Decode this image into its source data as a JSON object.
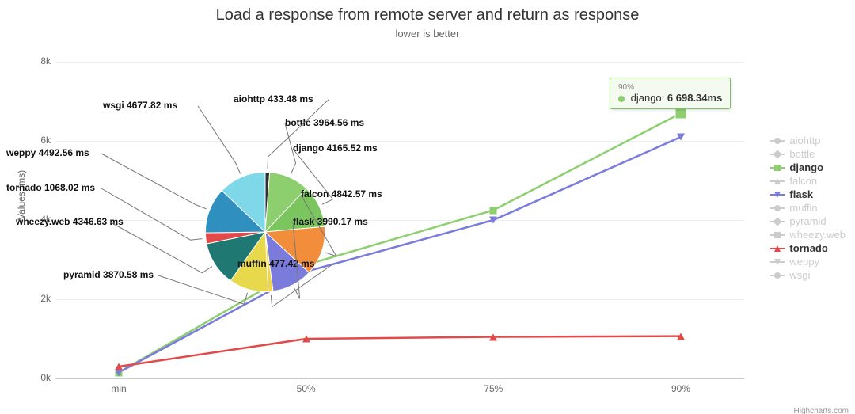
{
  "title": "Load a response from remote server and return as response",
  "subtitle": "lower is better",
  "y_axis_title": "Values (ms)",
  "credits": "Highcharts.com",
  "y_ticks": [
    "0k",
    "2k",
    "4k",
    "6k",
    "8k"
  ],
  "x_ticks": [
    "min",
    "50%",
    "75%",
    "90%"
  ],
  "tooltip": {
    "category": "90%",
    "series": "django",
    "value": "6 698.34ms",
    "color": "#8dce6f"
  },
  "legend": [
    {
      "name": "aiohttp",
      "active": false,
      "color": "#cccccc",
      "marker": "circle"
    },
    {
      "name": "bottle",
      "active": false,
      "color": "#cccccc",
      "marker": "diamond"
    },
    {
      "name": "django",
      "active": true,
      "color": "#8dce6f",
      "marker": "square",
      "bold": true
    },
    {
      "name": "falcon",
      "active": false,
      "color": "#cccccc",
      "marker": "tri-up"
    },
    {
      "name": "flask",
      "active": true,
      "color": "#7b7bdc",
      "marker": "tri-down",
      "bold": true
    },
    {
      "name": "muffin",
      "active": false,
      "color": "#cccccc",
      "marker": "circle"
    },
    {
      "name": "pyramid",
      "active": false,
      "color": "#cccccc",
      "marker": "diamond"
    },
    {
      "name": "wheezy.web",
      "active": false,
      "color": "#cccccc",
      "marker": "square"
    },
    {
      "name": "tornado",
      "active": true,
      "color": "#e24a4a",
      "marker": "tri-up",
      "bold": true
    },
    {
      "name": "weppy",
      "active": false,
      "color": "#cccccc",
      "marker": "tri-down"
    },
    {
      "name": "wsgi",
      "active": false,
      "color": "#cccccc",
      "marker": "circle"
    }
  ],
  "pie": [
    {
      "name": "aiohttp",
      "value": 433.48,
      "color": "#2f2f2f"
    },
    {
      "name": "bottle",
      "value": 3964.56,
      "color": "#8dce6f"
    },
    {
      "name": "django",
      "value": 4165.52,
      "color": "#7bc55e"
    },
    {
      "name": "falcon",
      "value": 4842.57,
      "color": "#f28d3c"
    },
    {
      "name": "flask",
      "value": 3990.17,
      "color": "#7b7bdc"
    },
    {
      "name": "muffin",
      "value": 477.42,
      "color": "#f2d44c"
    },
    {
      "name": "pyramid",
      "value": 3870.58,
      "color": "#e8d84c"
    },
    {
      "name": "wheezy.web",
      "value": 4346.63,
      "color": "#1f7872"
    },
    {
      "name": "tornado",
      "value": 1068.02,
      "color": "#e24a4a"
    },
    {
      "name": "weppy",
      "value": 4492.56,
      "color": "#2f8fbf"
    },
    {
      "name": "wsgi",
      "value": 4677.82,
      "color": "#7fd8e8"
    }
  ],
  "pie_label_unit": "ms",
  "chart_data": {
    "type": "line",
    "title": "Load a response from remote server and return as response",
    "subtitle": "lower is better",
    "xlabel": "",
    "ylabel": "Values (ms)",
    "categories": [
      "min",
      "50%",
      "75%",
      "90%"
    ],
    "ylim": [
      0,
      8000
    ],
    "series": [
      {
        "name": "django",
        "color": "#8dce6f",
        "values": [
          150,
          2870,
          4250,
          6698.34
        ]
      },
      {
        "name": "flask",
        "color": "#7b7bdc",
        "values": [
          150,
          2700,
          4000,
          6100
        ]
      },
      {
        "name": "tornado",
        "color": "#e24a4a",
        "values": [
          300,
          1000,
          1050,
          1068.02
        ]
      }
    ],
    "pie_overlay": {
      "type": "pie",
      "unit": "ms",
      "slices": [
        {
          "name": "aiohttp",
          "value": 433.48
        },
        {
          "name": "bottle",
          "value": 3964.56
        },
        {
          "name": "django",
          "value": 4165.52
        },
        {
          "name": "falcon",
          "value": 4842.57
        },
        {
          "name": "flask",
          "value": 3990.17
        },
        {
          "name": "muffin",
          "value": 477.42
        },
        {
          "name": "pyramid",
          "value": 3870.58
        },
        {
          "name": "wheezy.web",
          "value": 4346.63
        },
        {
          "name": "tornado",
          "value": 1068.02
        },
        {
          "name": "weppy",
          "value": 4492.56
        },
        {
          "name": "wsgi",
          "value": 4677.82
        }
      ]
    }
  }
}
